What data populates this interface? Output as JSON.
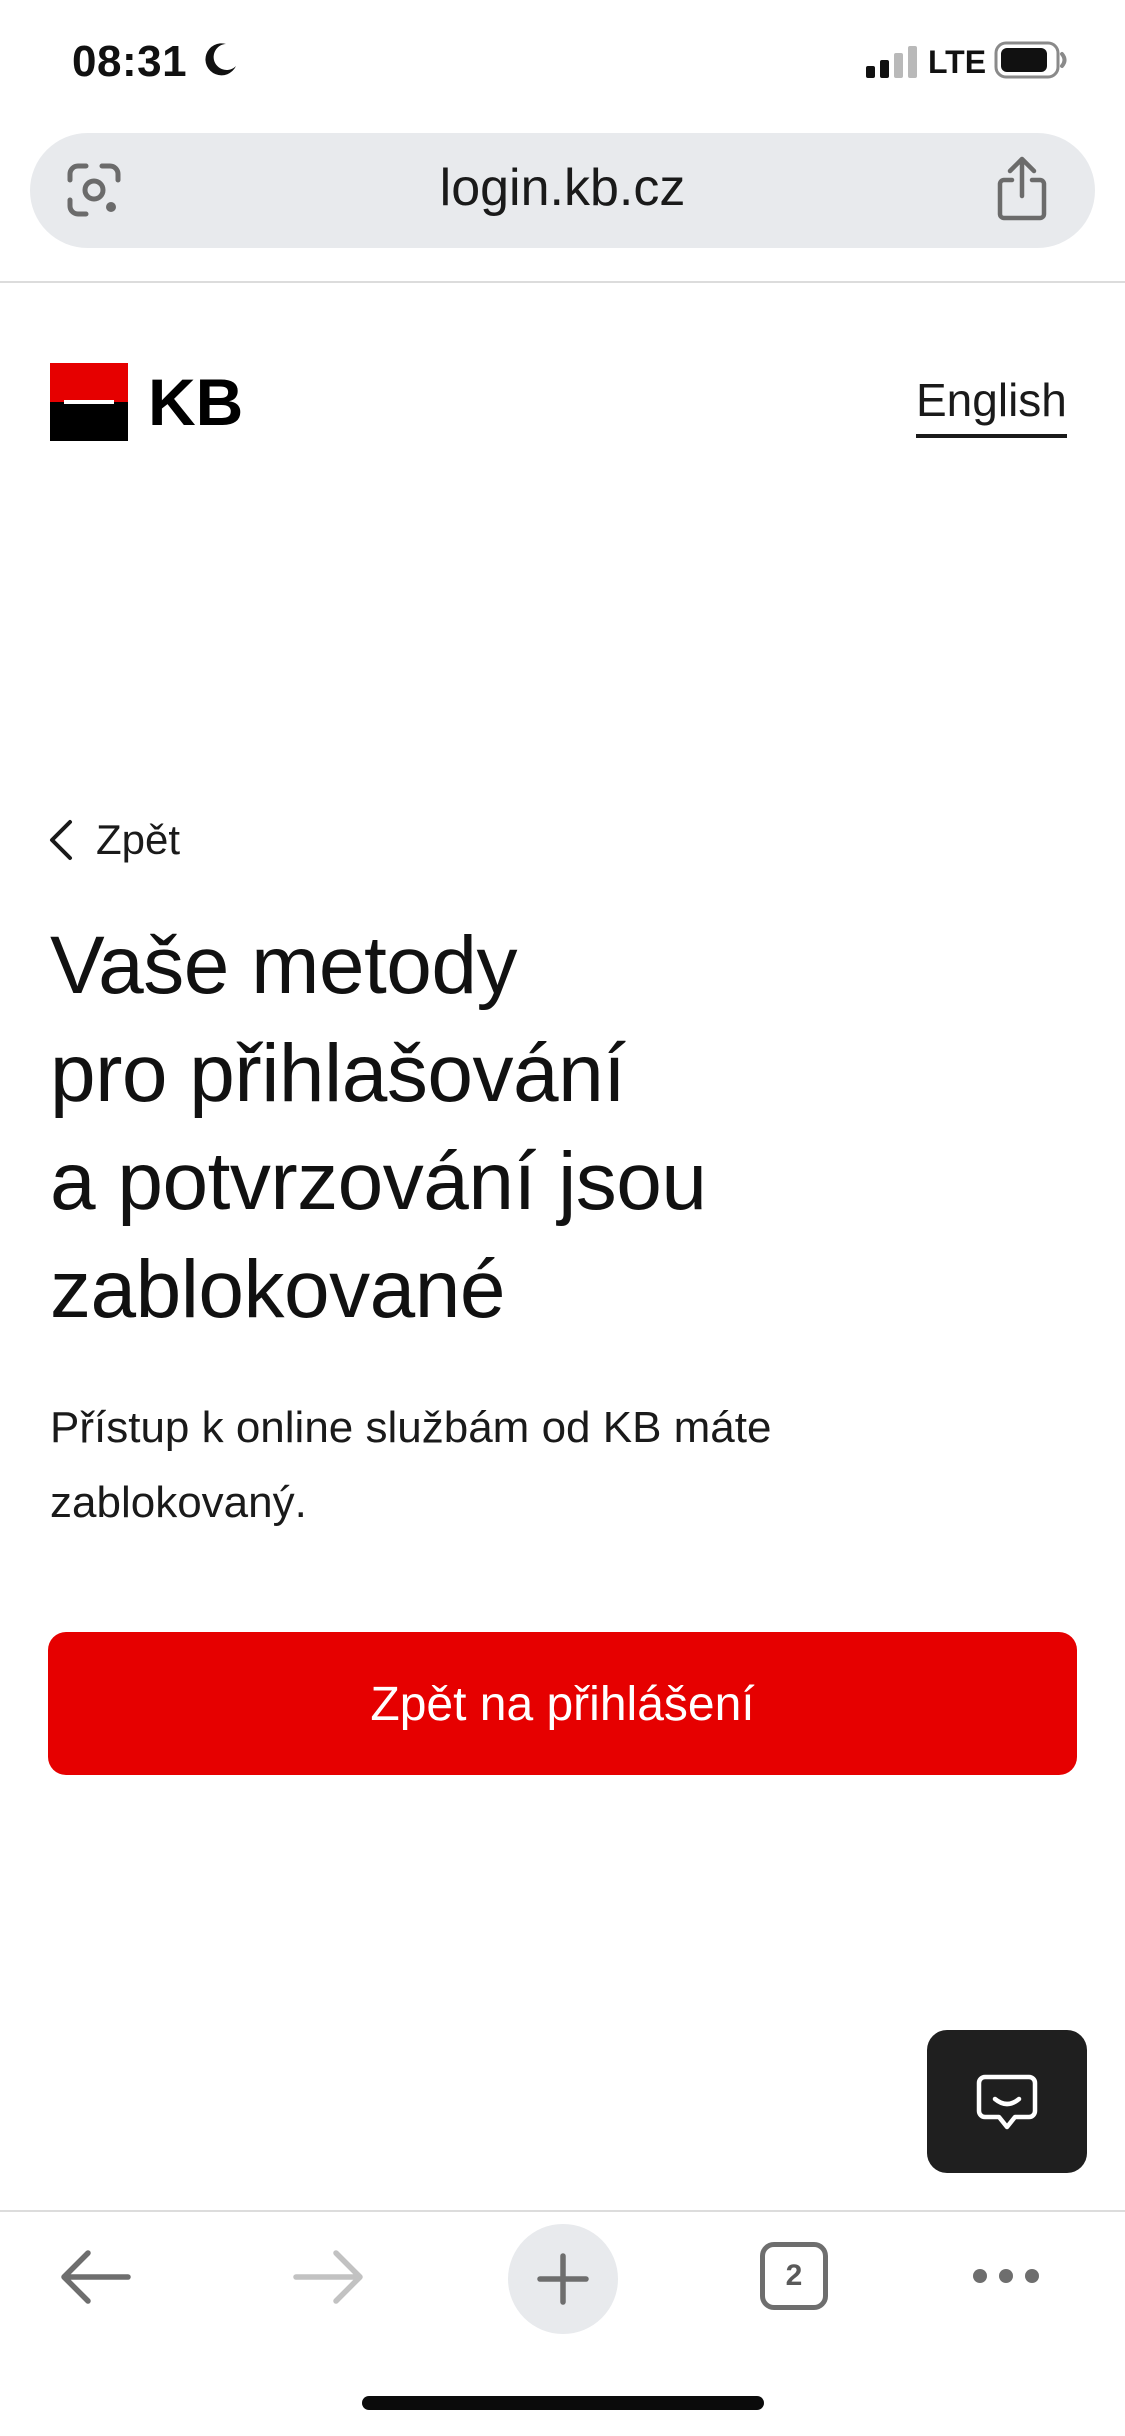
{
  "status_bar": {
    "time": "08:31",
    "moon_icon": "moon-icon",
    "network": "LTE"
  },
  "browser": {
    "url": "login.kb.cz",
    "tab_count": "2"
  },
  "header": {
    "brand_name": "KB",
    "language_link": "English"
  },
  "page": {
    "back_label": "Zpět",
    "title_lines": [
      "Vaše metody",
      "pro přihlašování",
      "a potvrzování jsou",
      "zablokované"
    ],
    "description": "Přístup k online službám od KB máte zablokovaný.",
    "primary_button": "Zpět na přihlášení"
  },
  "colors": {
    "brand_red": "#e60000",
    "chat_bg": "#1f1f1f"
  }
}
